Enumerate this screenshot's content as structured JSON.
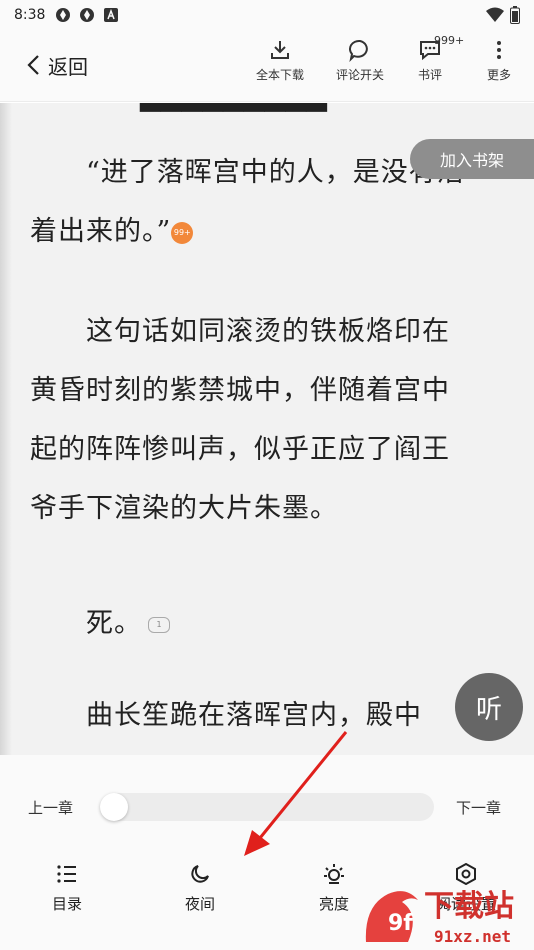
{
  "status_bar": {
    "time": "8:38"
  },
  "toolbar": {
    "back_label": "返回",
    "actions": [
      {
        "label": "全本下载",
        "icon": "download-icon"
      },
      {
        "label": "评论开关",
        "icon": "comment-toggle-icon"
      },
      {
        "label": "书评",
        "icon": "review-icon",
        "badge": "999+"
      },
      {
        "label": "更多",
        "icon": "more-icon"
      }
    ]
  },
  "reader": {
    "add_shelf_label": "加入书架",
    "paragraphs": [
      "“进了落晖宫中的人，是没有活着出来的。”",
      "这句话如同滚烫的铁板烙印在黄昏时刻的紫禁城中，伴随着宫中起的阵阵惨叫声，似乎正应了阎王爷手下渲染的大片朱墨。",
      "死。",
      "曲长笙跪在落晖宫内，殿中"
    ],
    "para1_line1": "“进了落晖宫中的人，是没有活",
    "para1_line2": "着出来的。”",
    "hot_badge": "99+",
    "para2_lines": [
      "这句话如同滚烫的铁板烙印在",
      "黄昏时刻的紫禁城中，伴随着宫中",
      "起的阵阵惨叫声，似乎正应了阎王",
      "爷手下渲染的大片朱墨。"
    ],
    "para3": "死。",
    "comment_count": "1",
    "para4": "曲长笙跪在落晖宫内，殿中",
    "listen_label": "听"
  },
  "progress": {
    "prev_label": "上一章",
    "next_label": "下一章",
    "value": 0
  },
  "bottom_nav": [
    {
      "label": "目录",
      "icon": "list-icon"
    },
    {
      "label": "夜间",
      "icon": "moon-icon"
    },
    {
      "label": "亮度",
      "icon": "brightness-icon"
    },
    {
      "label": "阅读设置",
      "icon": "settings-icon"
    }
  ],
  "watermark": {
    "text": "下载站",
    "url_text": "91xz.net"
  },
  "colors": {
    "accent_arrow": "#e0201c",
    "shelf_button": "#8e8e8e",
    "listen_button": "#666666",
    "page_bg": "#f2f2f2"
  }
}
